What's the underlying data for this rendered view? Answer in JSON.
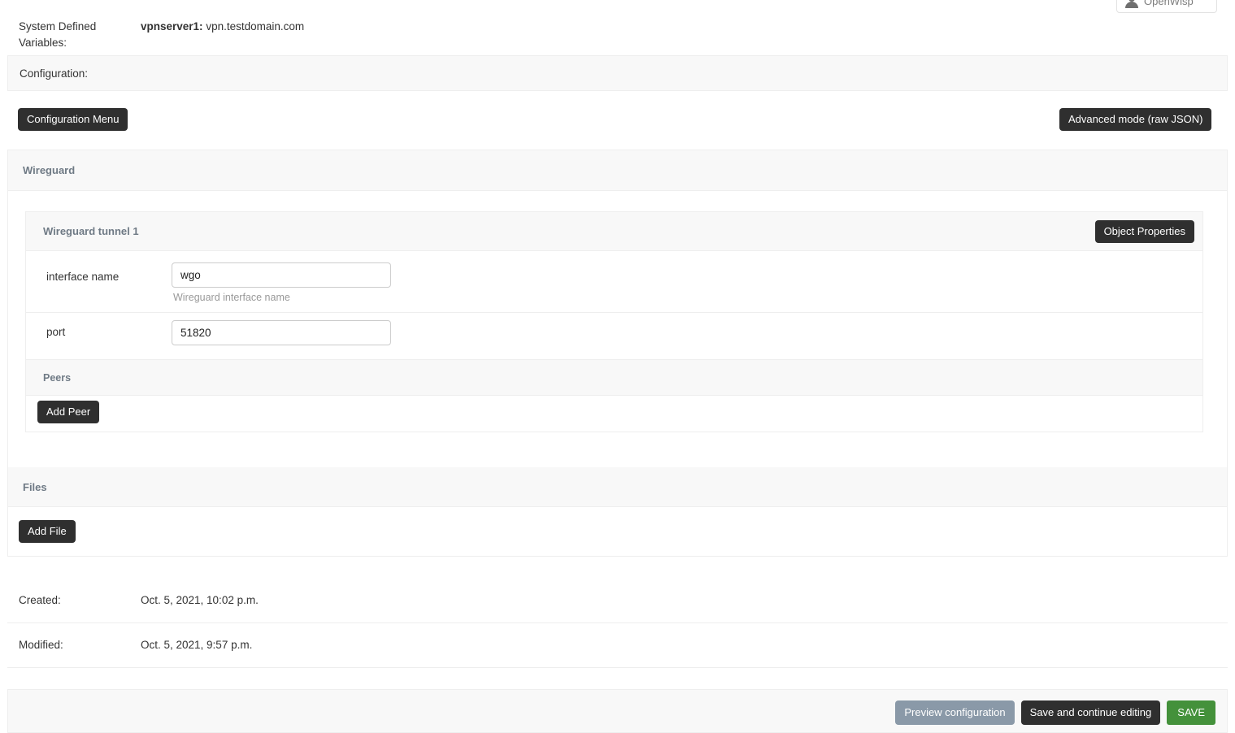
{
  "header": {
    "user_chip": {
      "label": "OpenWisp",
      "icon": "user-avatar-icon"
    }
  },
  "system_variables": {
    "label": "System Defined Variables:",
    "entries": [
      {
        "name": "vpnserver1:",
        "value": "vpn.testdomain.com"
      }
    ]
  },
  "configuration": {
    "section_label": "Configuration:",
    "configuration_menu_label": "Configuration Menu",
    "advanced_mode_label": "Advanced mode (raw JSON)"
  },
  "wireguard": {
    "section_title": "Wireguard",
    "tunnel": {
      "title": "Wireguard tunnel 1",
      "object_properties_label": "Object Properties",
      "fields": [
        {
          "label": "interface name",
          "value": "wgo",
          "placeholder": "",
          "help": "Wireguard interface name"
        },
        {
          "label": "port",
          "value": "51820",
          "placeholder": "",
          "help": ""
        }
      ],
      "peers": {
        "title": "Peers",
        "add_peer_label": "Add Peer"
      }
    }
  },
  "files": {
    "section_title": "Files",
    "add_file_label": "Add File"
  },
  "meta": [
    {
      "label": "Created:",
      "value": "Oct. 5, 2021, 10:02 p.m."
    },
    {
      "label": "Modified:",
      "value": "Oct. 5, 2021, 9:57 p.m."
    }
  ],
  "footer": {
    "preview_label": "Preview configuration",
    "save_continue_label": "Save and continue editing",
    "save_label": "SAVE"
  },
  "colors": {
    "dark_button": "#2f2f2f",
    "grey_button": "#8a99a8",
    "save_green": "#44913b",
    "panel_header_bg": "#f8f8f8",
    "border": "#eeeeee",
    "section_title_text": "#6f7a85"
  }
}
